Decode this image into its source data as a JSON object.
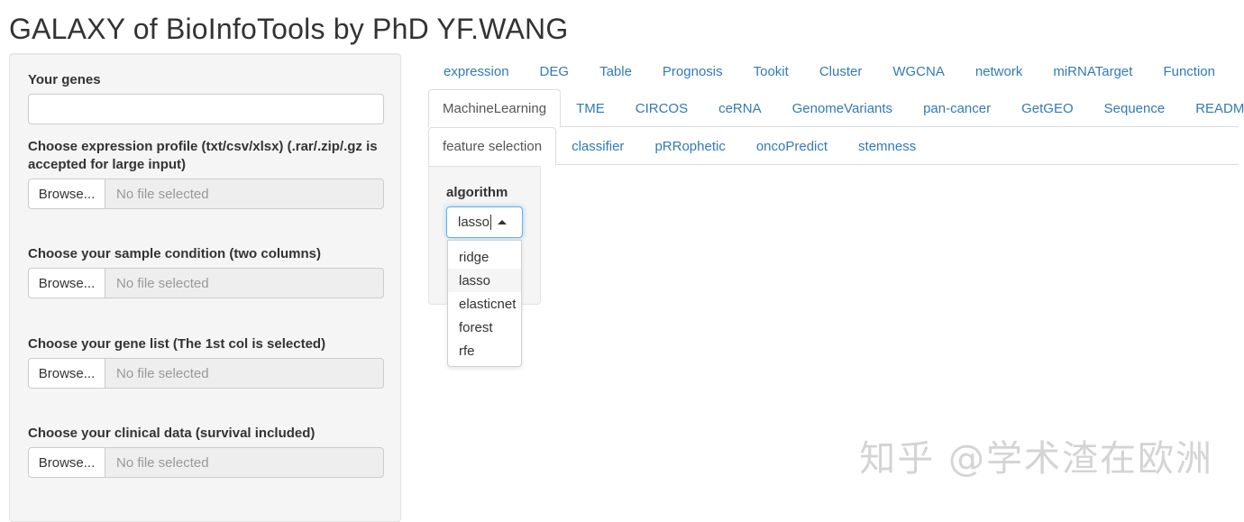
{
  "app_title": "GALAXY of BioInfoTools by PhD YF.WANG",
  "sidebar": {
    "genes_label": "Your genes",
    "genes_value": "",
    "expr_label": "Choose expression profile (txt/csv/xlsx) (.rar/.zip/.gz is accepted for large input)",
    "sample_label": "Choose your sample condition (two columns)",
    "genelist_label": "Choose your gene list (The 1st col is selected)",
    "clinical_label": "Choose your clinical data (survival included)",
    "browse_label": "Browse...",
    "no_file": "No file selected"
  },
  "tabs_row1": [
    "expression",
    "DEG",
    "Table",
    "Prognosis",
    "Tookit",
    "Cluster",
    "WGCNA",
    "network",
    "miRNATarget",
    "Function"
  ],
  "tabs_row2": [
    "MachineLearning",
    "TME",
    "CIRCOS",
    "ceRNA",
    "GenomeVariants",
    "pan-cancer",
    "GetGEO",
    "Sequence",
    "README"
  ],
  "tabs_row3": [
    "feature selection",
    "classifier",
    "pRRophetic",
    "oncoPredict",
    "stemness"
  ],
  "active_row2": "MachineLearning",
  "active_row3": "feature selection",
  "algorithm": {
    "label": "algorithm",
    "value": "lasso",
    "options": [
      "ridge",
      "lasso",
      "elasticnet",
      "forest",
      "rfe"
    ]
  },
  "watermark": "知乎 @学术渣在欧洲",
  "colors": {
    "link": "#337ab7",
    "well": "#f5f5f5",
    "focus": "#66afe9"
  },
  "icons": {
    "select_caret": "caret-up-icon"
  }
}
